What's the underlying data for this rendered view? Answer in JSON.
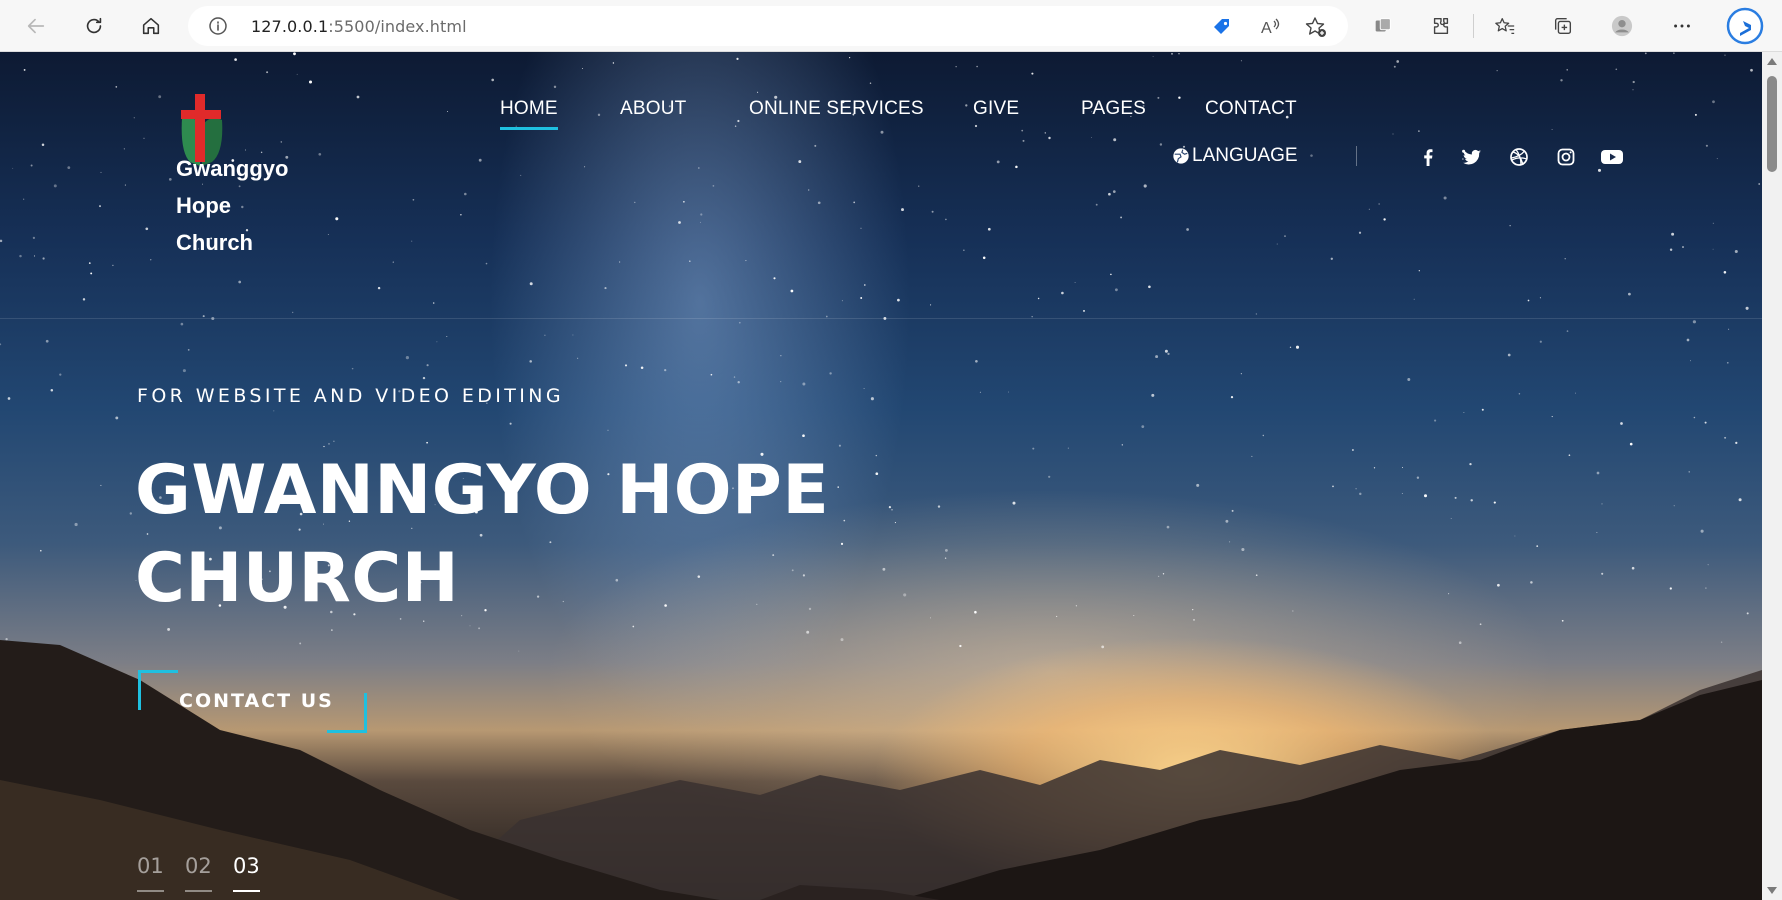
{
  "browser": {
    "url_host": "127.0.0.1",
    "url_rest": ":5500/index.html",
    "icons": [
      "back-icon",
      "refresh-icon",
      "home-icon",
      "info-icon",
      "coupon-icon",
      "read-aloud-icon",
      "favorite-add-icon",
      "split-screen-icon",
      "extensions-icon",
      "favorites-icon",
      "collections-icon",
      "profile-icon",
      "more-icon",
      "bing-icon"
    ]
  },
  "site": {
    "logo_name": [
      "Gwanggyo",
      "Hope",
      "Church"
    ],
    "nav": [
      "HOME",
      "ABOUT",
      "ONLINE SERVICES",
      "GIVE",
      "PAGES",
      "CONTACT"
    ],
    "active_nav": "HOME",
    "language": "LANGUAGE",
    "social_icons": [
      "facebook-icon",
      "twitter-icon",
      "dribbble-icon",
      "instagram-icon",
      "youtube-icon"
    ]
  },
  "hero": {
    "eyebrow": "FOR WEBSITE AND VIDEO EDITING",
    "headline_line1": "GWANNGYO HOPE",
    "headline_line2": "CHURCH",
    "cta": "CONTACT US",
    "slides": [
      "01",
      "02",
      "03"
    ],
    "active_slide": "03"
  },
  "colors": {
    "accent": "#1fc0e0",
    "cross_red": "#e02a2a",
    "cross_green": "#2e8b4f"
  }
}
